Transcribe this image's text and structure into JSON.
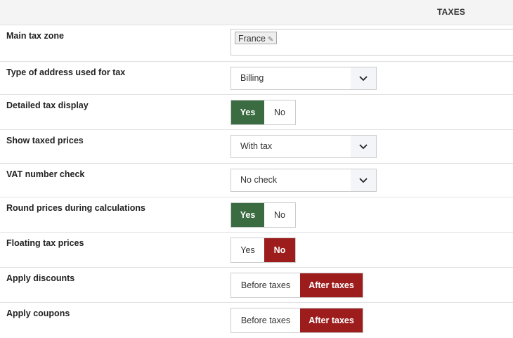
{
  "section_title": "TAXES",
  "rows": [
    {
      "label": "Main tax zone",
      "tag": "France"
    },
    {
      "label": "Type of address used for tax",
      "value": "Billing"
    },
    {
      "label": "Detailed tax display",
      "yes": "Yes",
      "no": "No",
      "selected": "Yes"
    },
    {
      "label": "Show taxed prices",
      "value": "With tax"
    },
    {
      "label": "VAT number check",
      "value": "No check"
    },
    {
      "label": "Round prices during calculations",
      "yes": "Yes",
      "no": "No",
      "selected": "Yes"
    },
    {
      "label": "Floating tax prices",
      "yes": "Yes",
      "no": "No",
      "selected": "No"
    },
    {
      "label": "Apply discounts",
      "before": "Before taxes",
      "after": "After taxes",
      "selected": "After taxes"
    },
    {
      "label": "Apply coupons",
      "before": "Before taxes",
      "after": "After taxes",
      "selected": "After taxes"
    }
  ],
  "colors": {
    "yes_active": "#3a6b41",
    "no_active": "#9d1d1d"
  },
  "icons": {
    "tag_edit": "pencil-icon",
    "dropdown": "chevron-down-icon"
  }
}
